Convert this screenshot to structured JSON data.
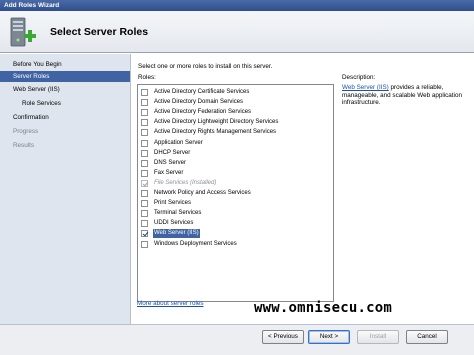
{
  "window": {
    "title": "Add Roles Wizard"
  },
  "header": {
    "title": "Select Server Roles",
    "icon": "server-roles-wizard-icon"
  },
  "nav": {
    "items": [
      {
        "label": "Before You Begin",
        "state": "normal"
      },
      {
        "label": "Server Roles",
        "state": "selected"
      },
      {
        "label": "Web Server (IIS)",
        "state": "normal"
      },
      {
        "label": "Role Services",
        "state": "sub"
      },
      {
        "label": "Confirmation",
        "state": "normal"
      },
      {
        "label": "Progress",
        "state": "disabled"
      },
      {
        "label": "Results",
        "state": "disabled"
      }
    ]
  },
  "main": {
    "intro": "Select one or more roles to install on this server.",
    "roles_label": "Roles:",
    "description_label": "Description:",
    "roles": [
      {
        "label": "Active Directory Certificate Services",
        "checked": false,
        "disabled": false,
        "selected": false
      },
      {
        "label": "Active Directory Domain Services",
        "checked": false,
        "disabled": false,
        "selected": false
      },
      {
        "label": "Active Directory Federation Services",
        "checked": false,
        "disabled": false,
        "selected": false
      },
      {
        "label": "Active Directory Lightweight Directory Services",
        "checked": false,
        "disabled": false,
        "selected": false
      },
      {
        "label": "Active Directory Rights Management Services",
        "checked": false,
        "disabled": false,
        "selected": false
      },
      {
        "label": "Application Server",
        "checked": false,
        "disabled": false,
        "selected": false
      },
      {
        "label": "DHCP Server",
        "checked": false,
        "disabled": false,
        "selected": false
      },
      {
        "label": "DNS Server",
        "checked": false,
        "disabled": false,
        "selected": false
      },
      {
        "label": "Fax Server",
        "checked": false,
        "disabled": false,
        "selected": false
      },
      {
        "label": "File Services  (Installed)",
        "checked": true,
        "disabled": true,
        "selected": false
      },
      {
        "label": "Network Policy and Access Services",
        "checked": false,
        "disabled": false,
        "selected": false
      },
      {
        "label": "Print Services",
        "checked": false,
        "disabled": false,
        "selected": false
      },
      {
        "label": "Terminal Services",
        "checked": false,
        "disabled": false,
        "selected": false
      },
      {
        "label": "UDDI Services",
        "checked": false,
        "disabled": false,
        "selected": false
      },
      {
        "label": "Web Server (IIS)",
        "checked": true,
        "disabled": false,
        "selected": true
      },
      {
        "label": "Windows Deployment Services",
        "checked": false,
        "disabled": false,
        "selected": false
      }
    ],
    "description": {
      "link": "Web Server (IIS)",
      "text": " provides a reliable, manageable, and scalable Web application infrastructure."
    },
    "more_link": "More about server roles"
  },
  "watermark": "www.omnisecu.com",
  "footer": {
    "previous_label": "< Previous",
    "next_label": "Next >",
    "install_label": "Install",
    "cancel_label": "Cancel"
  },
  "colors": {
    "selection_blue": "#3f63a3",
    "nav_background": "#dfe5ee",
    "link_blue": "#1a4fb5"
  }
}
